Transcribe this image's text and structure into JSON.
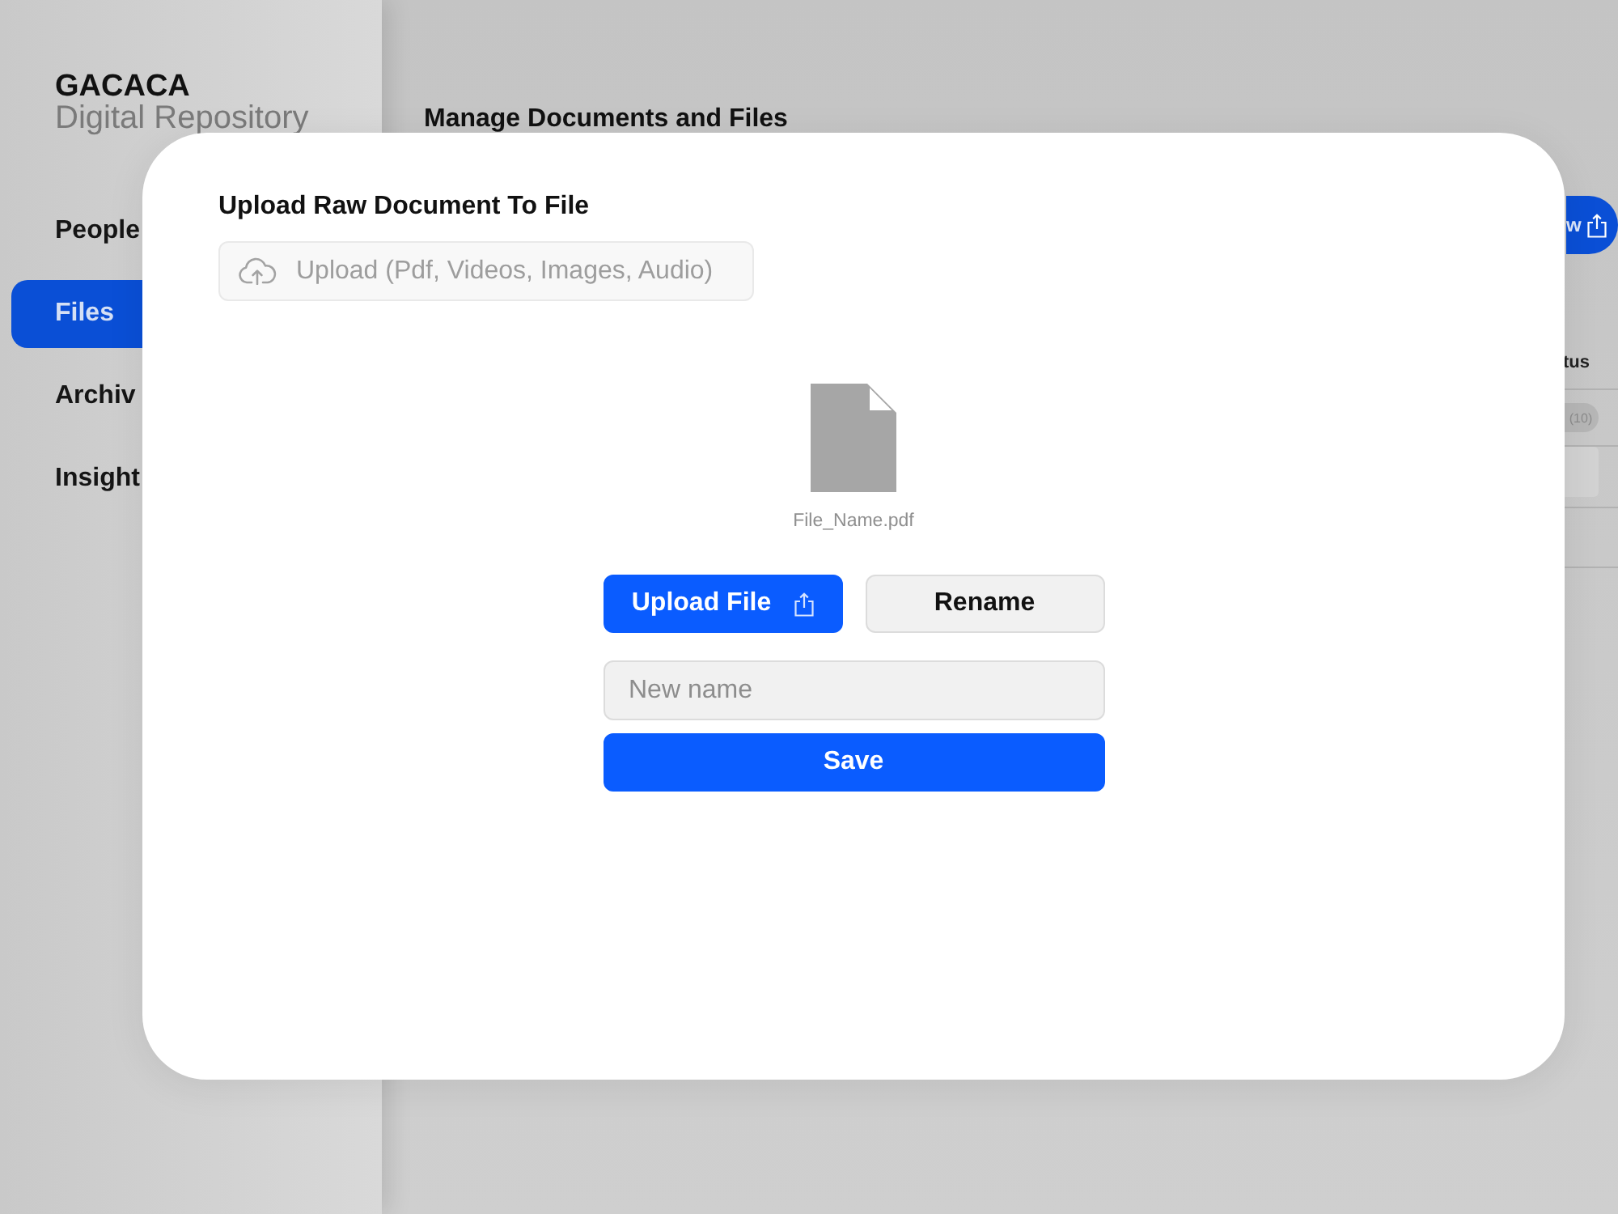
{
  "sidebar": {
    "brand": "GACACA",
    "subtitle": "Digital Repository",
    "items": [
      {
        "label": "People",
        "selected": false
      },
      {
        "label": "Files",
        "selected": true
      },
      {
        "label": "Archiv",
        "selected": false
      },
      {
        "label": "Insight",
        "selected": false
      }
    ]
  },
  "main": {
    "title": "Manage Documents and Files",
    "action_button": {
      "label": "w"
    },
    "table": {
      "columns": [
        "tus"
      ],
      "rows": [
        {
          "status": "(10)"
        }
      ]
    }
  },
  "dialog": {
    "title": "Upload Raw Document To File",
    "upload_field": {
      "placeholder": "Upload (Pdf, Videos, Images, Audio)"
    },
    "file": {
      "name": "File_Name.pdf"
    },
    "buttons": [
      {
        "label": "Upload File",
        "kind": "primary"
      },
      {
        "label": "Rename",
        "kind": "secondary"
      }
    ],
    "rename_field": {
      "placeholder": "New name"
    },
    "save_button": {
      "label": "Save"
    }
  }
}
